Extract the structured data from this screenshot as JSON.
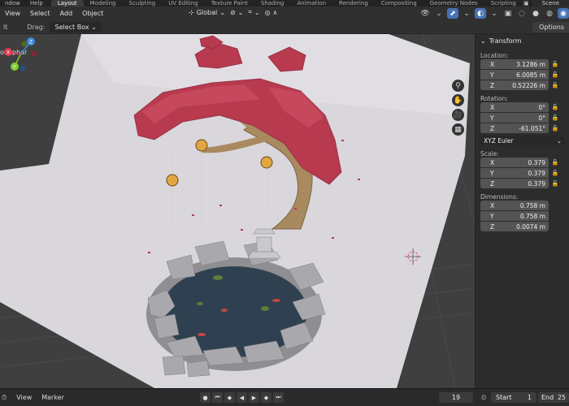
{
  "topbar": {
    "menu_stub": [
      "ndow",
      "Help"
    ],
    "tabs": [
      "Layout",
      "Modeling",
      "Sculpting",
      "UV Editing",
      "Texture Paint",
      "Shading",
      "Animation",
      "Rendering",
      "Compositing",
      "Geometry Nodes",
      "Scripting"
    ],
    "active_tab": "Layout",
    "scene_label": "Scene"
  },
  "header": {
    "menus": [
      "View",
      "Select",
      "Add",
      "Object"
    ],
    "orientation": "Global"
  },
  "toolbar": {
    "mode_stub": "lt",
    "drag_label": "Drag:",
    "drag_value": "Select Box",
    "options_label": "Options"
  },
  "viewport": {
    "object_name": "onuphar",
    "gizmo": {
      "x": "X",
      "y": "Y",
      "z": "Z"
    }
  },
  "transform_panel": {
    "title": "Transform",
    "location_label": "Location:",
    "location": [
      {
        "axis": "X",
        "value": "3.1286 m"
      },
      {
        "axis": "Y",
        "value": "6.0085 m"
      },
      {
        "axis": "Z",
        "value": "0.52226 m"
      }
    ],
    "rotation_label": "Rotation:",
    "rotation": [
      {
        "axis": "X",
        "value": "0°"
      },
      {
        "axis": "Y",
        "value": "0°"
      },
      {
        "axis": "Z",
        "value": "-61.051°"
      }
    ],
    "rotation_mode": "XYZ Euler",
    "scale_label": "Scale:",
    "scale": [
      {
        "axis": "X",
        "value": "0.379"
      },
      {
        "axis": "Y",
        "value": "0.379"
      },
      {
        "axis": "Z",
        "value": "0.379"
      }
    ],
    "dimensions_label": "Dimensions:",
    "dimensions": [
      {
        "axis": "X",
        "value": "0.758 m"
      },
      {
        "axis": "Y",
        "value": "0.758 m"
      },
      {
        "axis": "Z",
        "value": "0.0074 m"
      }
    ]
  },
  "timeline": {
    "menus": [
      "View",
      "Marker"
    ],
    "current_frame": "19",
    "start_label": "Start",
    "start_value": "1",
    "end_label": "End",
    "end_value": "25"
  }
}
